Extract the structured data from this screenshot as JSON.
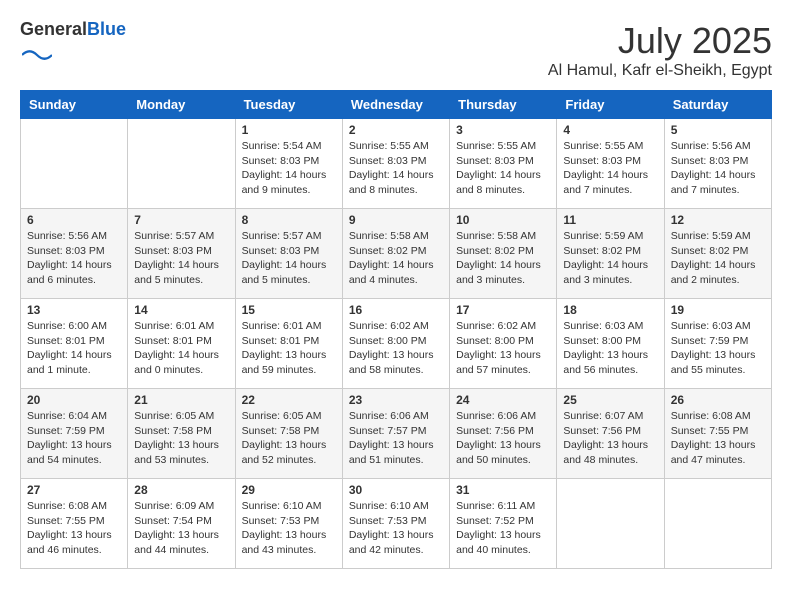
{
  "header": {
    "logo_general": "General",
    "logo_blue": "Blue",
    "month_title": "July 2025",
    "location": "Al Hamul, Kafr el-Sheikh, Egypt"
  },
  "days_of_week": [
    "Sunday",
    "Monday",
    "Tuesday",
    "Wednesday",
    "Thursday",
    "Friday",
    "Saturday"
  ],
  "weeks": [
    [
      {
        "day": "",
        "info": ""
      },
      {
        "day": "",
        "info": ""
      },
      {
        "day": "1",
        "sunrise": "5:54 AM",
        "sunset": "8:03 PM",
        "daylight": "14 hours and 9 minutes."
      },
      {
        "day": "2",
        "sunrise": "5:55 AM",
        "sunset": "8:03 PM",
        "daylight": "14 hours and 8 minutes."
      },
      {
        "day": "3",
        "sunrise": "5:55 AM",
        "sunset": "8:03 PM",
        "daylight": "14 hours and 8 minutes."
      },
      {
        "day": "4",
        "sunrise": "5:55 AM",
        "sunset": "8:03 PM",
        "daylight": "14 hours and 7 minutes."
      },
      {
        "day": "5",
        "sunrise": "5:56 AM",
        "sunset": "8:03 PM",
        "daylight": "14 hours and 7 minutes."
      }
    ],
    [
      {
        "day": "6",
        "sunrise": "5:56 AM",
        "sunset": "8:03 PM",
        "daylight": "14 hours and 6 minutes."
      },
      {
        "day": "7",
        "sunrise": "5:57 AM",
        "sunset": "8:03 PM",
        "daylight": "14 hours and 5 minutes."
      },
      {
        "day": "8",
        "sunrise": "5:57 AM",
        "sunset": "8:03 PM",
        "daylight": "14 hours and 5 minutes."
      },
      {
        "day": "9",
        "sunrise": "5:58 AM",
        "sunset": "8:02 PM",
        "daylight": "14 hours and 4 minutes."
      },
      {
        "day": "10",
        "sunrise": "5:58 AM",
        "sunset": "8:02 PM",
        "daylight": "14 hours and 3 minutes."
      },
      {
        "day": "11",
        "sunrise": "5:59 AM",
        "sunset": "8:02 PM",
        "daylight": "14 hours and 3 minutes."
      },
      {
        "day": "12",
        "sunrise": "5:59 AM",
        "sunset": "8:02 PM",
        "daylight": "14 hours and 2 minutes."
      }
    ],
    [
      {
        "day": "13",
        "sunrise": "6:00 AM",
        "sunset": "8:01 PM",
        "daylight": "14 hours and 1 minute."
      },
      {
        "day": "14",
        "sunrise": "6:01 AM",
        "sunset": "8:01 PM",
        "daylight": "14 hours and 0 minutes."
      },
      {
        "day": "15",
        "sunrise": "6:01 AM",
        "sunset": "8:01 PM",
        "daylight": "13 hours and 59 minutes."
      },
      {
        "day": "16",
        "sunrise": "6:02 AM",
        "sunset": "8:00 PM",
        "daylight": "13 hours and 58 minutes."
      },
      {
        "day": "17",
        "sunrise": "6:02 AM",
        "sunset": "8:00 PM",
        "daylight": "13 hours and 57 minutes."
      },
      {
        "day": "18",
        "sunrise": "6:03 AM",
        "sunset": "8:00 PM",
        "daylight": "13 hours and 56 minutes."
      },
      {
        "day": "19",
        "sunrise": "6:03 AM",
        "sunset": "7:59 PM",
        "daylight": "13 hours and 55 minutes."
      }
    ],
    [
      {
        "day": "20",
        "sunrise": "6:04 AM",
        "sunset": "7:59 PM",
        "daylight": "13 hours and 54 minutes."
      },
      {
        "day": "21",
        "sunrise": "6:05 AM",
        "sunset": "7:58 PM",
        "daylight": "13 hours and 53 minutes."
      },
      {
        "day": "22",
        "sunrise": "6:05 AM",
        "sunset": "7:58 PM",
        "daylight": "13 hours and 52 minutes."
      },
      {
        "day": "23",
        "sunrise": "6:06 AM",
        "sunset": "7:57 PM",
        "daylight": "13 hours and 51 minutes."
      },
      {
        "day": "24",
        "sunrise": "6:06 AM",
        "sunset": "7:56 PM",
        "daylight": "13 hours and 50 minutes."
      },
      {
        "day": "25",
        "sunrise": "6:07 AM",
        "sunset": "7:56 PM",
        "daylight": "13 hours and 48 minutes."
      },
      {
        "day": "26",
        "sunrise": "6:08 AM",
        "sunset": "7:55 PM",
        "daylight": "13 hours and 47 minutes."
      }
    ],
    [
      {
        "day": "27",
        "sunrise": "6:08 AM",
        "sunset": "7:55 PM",
        "daylight": "13 hours and 46 minutes."
      },
      {
        "day": "28",
        "sunrise": "6:09 AM",
        "sunset": "7:54 PM",
        "daylight": "13 hours and 44 minutes."
      },
      {
        "day": "29",
        "sunrise": "6:10 AM",
        "sunset": "7:53 PM",
        "daylight": "13 hours and 43 minutes."
      },
      {
        "day": "30",
        "sunrise": "6:10 AM",
        "sunset": "7:53 PM",
        "daylight": "13 hours and 42 minutes."
      },
      {
        "day": "31",
        "sunrise": "6:11 AM",
        "sunset": "7:52 PM",
        "daylight": "13 hours and 40 minutes."
      },
      {
        "day": "",
        "info": ""
      },
      {
        "day": "",
        "info": ""
      }
    ]
  ]
}
